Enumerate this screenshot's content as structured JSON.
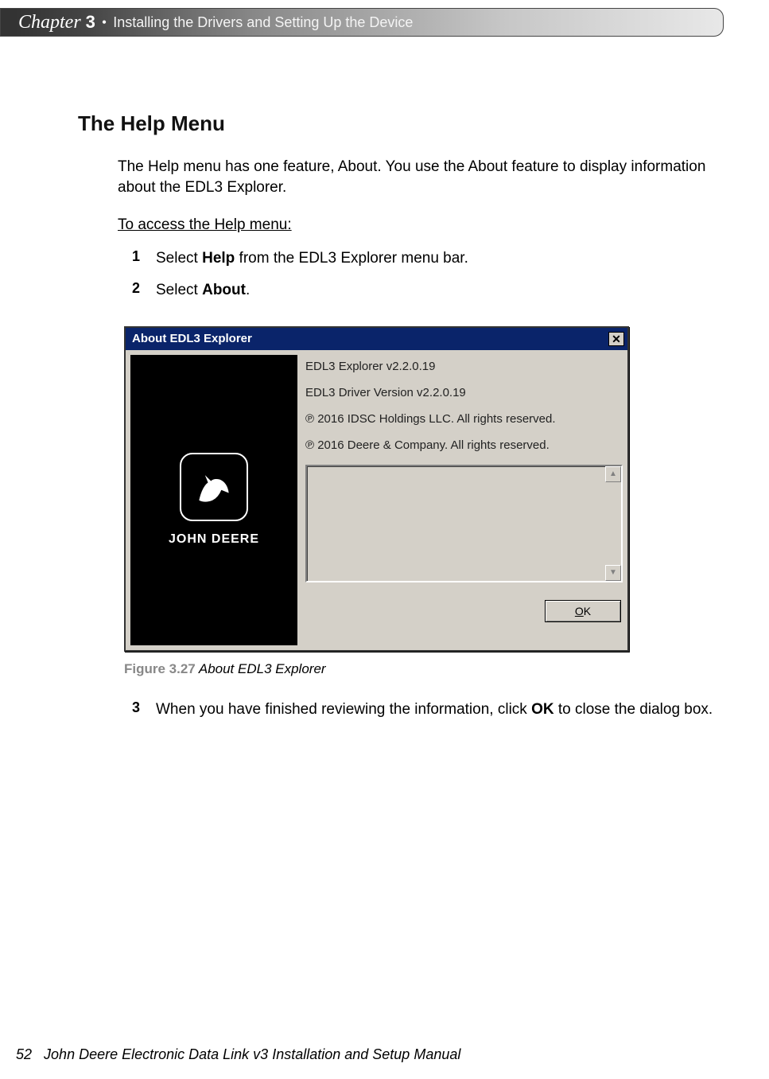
{
  "header": {
    "chapter_word": "Chapter",
    "chapter_num": "3",
    "separator": "•",
    "chapter_title": "Installing the Drivers and Setting Up the Device"
  },
  "section_title": "The Help Menu",
  "intro": "The Help menu has one feature, About. You use the About feature to display information about the EDL3 Explorer.",
  "subhead": "To access the Help menu:",
  "steps": {
    "s1": {
      "n": "1",
      "pre": "Select ",
      "bold": "Help",
      "post": " from the EDL3 Explorer menu bar."
    },
    "s2": {
      "n": "2",
      "pre": "Select ",
      "bold": "About",
      "post": "."
    },
    "s3": {
      "n": "3",
      "pre": "When you have finished reviewing the information, click ",
      "bold": "OK",
      "post": " to close the dialog box."
    }
  },
  "dialog": {
    "title": "About EDL3 Explorer",
    "close_glyph": "✕",
    "brand": "JOHN DEERE",
    "lines": {
      "l1": "EDL3 Explorer v2.2.0.19",
      "l2": "EDL3 Driver Version v2.2.0.19",
      "l3": "℗ 2016 IDSC Holdings LLC. All rights reserved.",
      "l4": "℗ 2016 Deere & Company. All rights reserved."
    },
    "ok_u": "O",
    "ok_rest": "K",
    "scroll_up": "▲",
    "scroll_down": "▼"
  },
  "caption": {
    "label": "Figure 3.27",
    "text": " About EDL3 Explorer"
  },
  "footer": {
    "page": "52",
    "title": "John Deere Electronic Data Link v3 Installation and Setup Manual"
  }
}
